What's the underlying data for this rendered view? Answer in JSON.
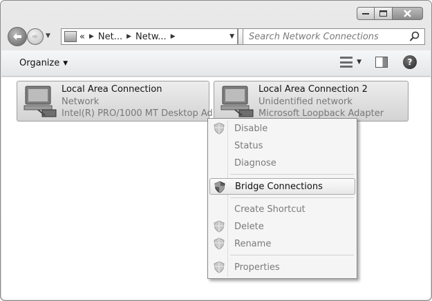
{
  "window": {
    "caption_buttons": {
      "minimize_icon": "minimize-icon",
      "maximize_icon": "maximize-icon",
      "close_icon": "close-icon"
    }
  },
  "address_bar": {
    "overflow": "«",
    "crumbs": [
      "Net...",
      "Netw..."
    ],
    "icon": "network-folder-icon"
  },
  "search": {
    "placeholder": "Search Network Connections"
  },
  "toolbar": {
    "organize_label": "Organize"
  },
  "connections": [
    {
      "name": "Local Area Connection",
      "status": "Network",
      "adapter": "Intel(R) PRO/1000 MT Desktop Ad..."
    },
    {
      "name": "Local Area Connection 2",
      "status": "Unidentified network",
      "adapter": "Microsoft Loopback Adapter"
    }
  ],
  "context_menu": {
    "items": [
      {
        "label": "Disable",
        "shield": true,
        "enabled": false
      },
      {
        "label": "Status",
        "shield": false,
        "enabled": false
      },
      {
        "label": "Diagnose",
        "shield": false,
        "enabled": false
      },
      {
        "label": "Bridge Connections",
        "shield": true,
        "enabled": true,
        "highlighted": true
      },
      {
        "label": "Create Shortcut",
        "shield": false,
        "enabled": false
      },
      {
        "label": "Delete",
        "shield": true,
        "enabled": false
      },
      {
        "label": "Rename",
        "shield": true,
        "enabled": false
      },
      {
        "label": "Properties",
        "shield": true,
        "enabled": false
      }
    ]
  }
}
